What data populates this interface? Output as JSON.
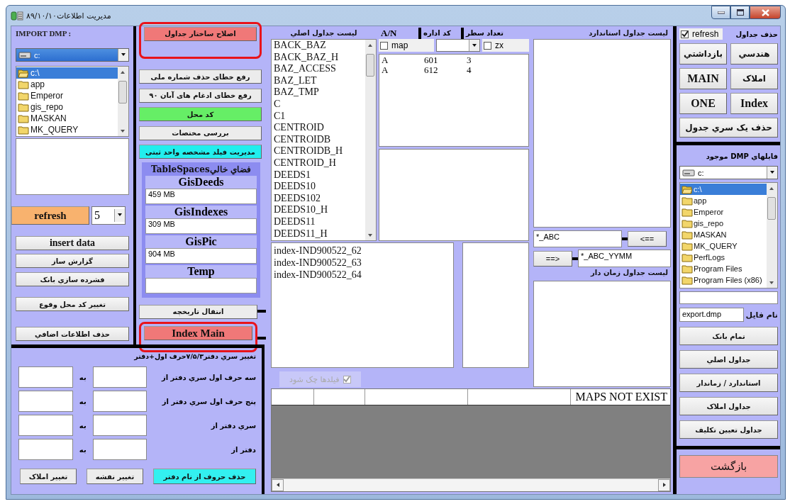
{
  "window": {
    "title": "مدیریت اطلاعات۸۹/۱۰/۱۰"
  },
  "import_panel": {
    "label": "IMPORT DMP :",
    "drive": "c:",
    "folders": [
      {
        "name": "c:\\",
        "selected": true
      },
      {
        "name": "app",
        "selected": false
      },
      {
        "name": "Emperor",
        "selected": false
      },
      {
        "name": "gis_repo",
        "selected": false
      },
      {
        "name": "MASKAN",
        "selected": false
      },
      {
        "name": "MK_QUERY",
        "selected": false
      }
    ],
    "refresh_button": "refresh",
    "refresh_interval": "5",
    "buttons": [
      "insert data",
      "گزارش ساز",
      "فشرده سازي بانک",
      "تغيير کد محل وقوع",
      "حذف اطلاعات اضافي"
    ]
  },
  "tools": {
    "buttons": [
      {
        "label": "اصلاح ساختار جداول",
        "color": "#f07878",
        "highlighted": true
      },
      {
        "label": "رفع خطای حذف شماره ملی",
        "color": "#ececec",
        "highlighted": false
      },
      {
        "label": "رفع خطای ادغام های آبان ۹۰",
        "color": "#ececec",
        "highlighted": false
      },
      {
        "label": "کد محل",
        "color": "#66ee66",
        "highlighted": false
      },
      {
        "label": "بررسی مختصات",
        "color": "#ececec",
        "highlighted": false
      },
      {
        "label": "مدیریت فیلد مشخصه واحد ثبتی",
        "color": "#22eeee",
        "highlighted": false
      }
    ],
    "tablespaces": {
      "title": "فضاي خاليTableSpaces",
      "items": [
        {
          "name": "GisDeeds",
          "value": "459 MB"
        },
        {
          "name": "GisIndexes",
          "value": "309 MB"
        },
        {
          "name": "GisPic",
          "value": "904 MB"
        },
        {
          "name": "Temp"
        }
      ]
    },
    "history_buttons": [
      {
        "label": "انتقال  تاریخچه",
        "color": "#ececec",
        "highlighted": false
      },
      {
        "label": "Index Main",
        "color": "#f07878",
        "highlighted": true
      }
    ]
  },
  "tables": {
    "title": "ليست جداول اصلي",
    "items": [
      "BACK_BAZ",
      "BACK_BAZ_H",
      "BAZ_ACCESS",
      "BAZ_LET",
      "BAZ_TMP",
      "C",
      "C1",
      "CENTROID",
      "CENTROIDB",
      "CENTROIDB_H",
      "CENTROID_H",
      "DEEDS1",
      "DEEDS10",
      "DEEDS102",
      "DEEDS10_H",
      "DEEDS11",
      "DEEDS11_H"
    ]
  },
  "details": {
    "columns": [
      "تعداد سطر",
      "کد اداره",
      "A/N"
    ],
    "map_checkbox": {
      "label": "map",
      "checked": false
    },
    "zx_checkbox": {
      "label": "zx",
      "checked": false
    },
    "rows": [
      [
        "3",
        "601",
        "A"
      ],
      [
        "4",
        "612",
        "A"
      ]
    ]
  },
  "indexes": {
    "items": [
      "index-IND900522_62",
      "index-IND900522_63",
      "index-IND900522_64"
    ],
    "check_fields": {
      "label": "فيلدها چک شود",
      "checked": true,
      "disabled": true
    }
  },
  "grid": {
    "header_text": "MAPS NOT EXIST"
  },
  "standard": {
    "title": "ليست جداول استاندارد",
    "pattern": "*_ABC",
    "left_button": "<==",
    "right_button": "==>",
    "dated_pattern": "*_ABC_YYMM",
    "dated_title": "ليست جداول زمان دار"
  },
  "delete_panel": {
    "title": "حذف جداول",
    "refresh": {
      "label": "refresh",
      "checked": true
    },
    "buttons": [
      "هندسي",
      "بازداشتي",
      "املاک",
      "MAIN",
      "Index",
      "ONE"
    ],
    "series_button": "حذف یک سري جدول"
  },
  "dmp_panel": {
    "title": "فايلهاي DMP موجود",
    "drive": "c:",
    "folders": [
      {
        "name": "c:\\",
        "selected": true
      },
      {
        "name": "app",
        "selected": false
      },
      {
        "name": "Emperor",
        "selected": false
      },
      {
        "name": "gis_repo",
        "selected": false
      },
      {
        "name": "MASKAN",
        "selected": false
      },
      {
        "name": "MK_QUERY",
        "selected": false
      },
      {
        "name": "PerfLogs",
        "selected": false
      },
      {
        "name": "Program Files",
        "selected": false
      },
      {
        "name": "Program Files (x86)",
        "selected": false
      }
    ],
    "file_label": "نام فايل",
    "file_name": "export.dmp",
    "buttons": [
      "تمام بانک",
      "جداول اصلي",
      "استاندارد / زماندار",
      "جداول املاک",
      "جداول تعیین تکلیف"
    ]
  },
  "back_button": "بازگشت",
  "series_panel": {
    "title": "تغيير سري دفتر۷/۵/۳حرف اول+دفتر",
    "rows": [
      {
        "label": "سه حرف اول سري دفتر از",
        "to": "به"
      },
      {
        "label": "پنج حرف اول  سري دفتر از",
        "to": "به"
      },
      {
        "label": "سري دفتر از",
        "to": "به"
      },
      {
        "label": "دفتر از",
        "to": "به"
      }
    ],
    "buttons": [
      {
        "label": "حذف حروف از نام دفتر",
        "color": "#33f0f0"
      },
      {
        "label": "تغيير نقشه",
        "color": "#ececec"
      },
      {
        "label": "تغيير املاک",
        "color": "#ececec"
      }
    ]
  }
}
